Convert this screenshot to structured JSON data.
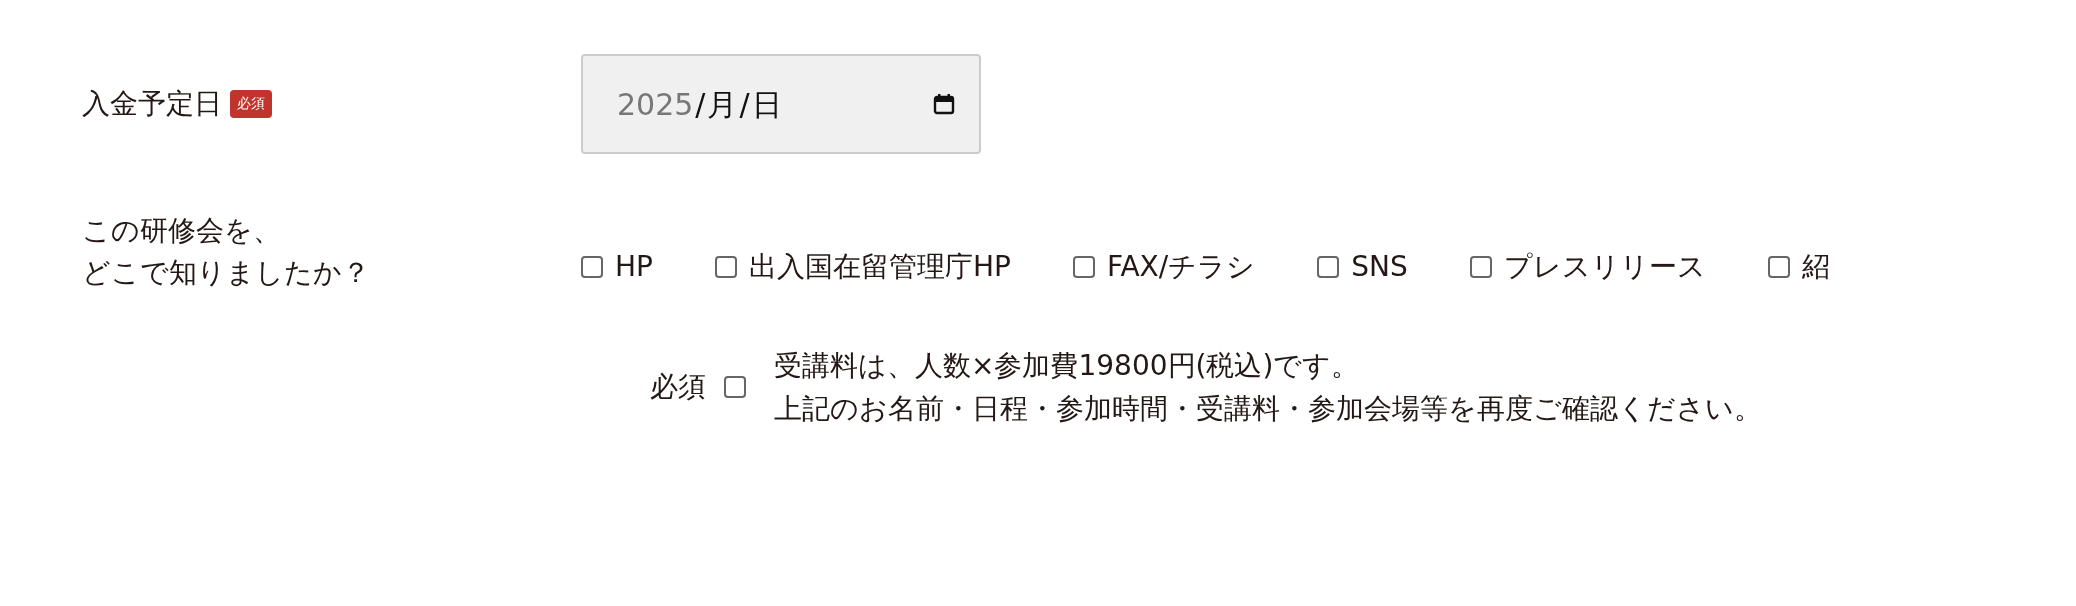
{
  "payment_date": {
    "label": "入金予定日",
    "badge": "必須",
    "segments": [
      {
        "text": "2025",
        "dimmed": true
      },
      {
        "text": "/",
        "dimmed": false
      },
      {
        "text": "月",
        "dimmed": false
      },
      {
        "text": "/",
        "dimmed": false
      },
      {
        "text": "日",
        "dimmed": false
      }
    ]
  },
  "source_question": {
    "label_lines": [
      "この研修会を、",
      "どこで知りましたか？"
    ],
    "options": [
      {
        "label": "HP",
        "checked": false
      },
      {
        "label": "出入国在留管理庁HP",
        "checked": false
      },
      {
        "label": "FAX/チラシ",
        "checked": false
      },
      {
        "label": "SNS",
        "checked": false
      },
      {
        "label": "プレスリリース",
        "checked": false
      },
      {
        "label": "紹",
        "checked": false
      }
    ]
  },
  "consent": {
    "label": "必須",
    "checked": false,
    "text_lines": [
      "受講料は、人数×参加費19800円(税込)です。",
      "上記のお名前・日程・参加時間・受講料・参加会場等を再度ご確認ください。"
    ]
  }
}
